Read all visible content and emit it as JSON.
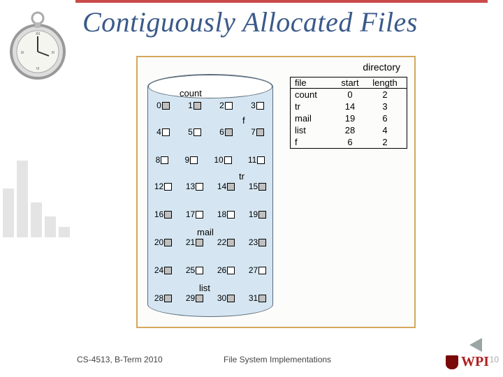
{
  "title": "Contiguously Allocated Files",
  "footer": {
    "course": "CS-4513, B-Term 2010",
    "topic": "File System Implementations",
    "slide": "10",
    "logo_text": "WPI"
  },
  "directory": {
    "title": "directory",
    "headers": {
      "file": "file",
      "start": "start",
      "length": "length"
    },
    "rows": [
      {
        "file": "count",
        "start": "0",
        "length": "2"
      },
      {
        "file": "tr",
        "start": "14",
        "length": "3"
      },
      {
        "file": "mail",
        "start": "19",
        "length": "6"
      },
      {
        "file": "list",
        "start": "28",
        "length": "4"
      },
      {
        "file": "f",
        "start": "6",
        "length": "2"
      }
    ]
  },
  "disk": {
    "labels": {
      "count": "count",
      "f": "f",
      "tr": "tr",
      "mail": "mail",
      "list": "list"
    },
    "rows": [
      [
        {
          "n": "0",
          "u": true
        },
        {
          "n": "1",
          "u": true
        },
        {
          "n": "2",
          "u": false
        },
        {
          "n": "3",
          "u": false
        }
      ],
      [
        {
          "n": "4",
          "u": false
        },
        {
          "n": "5",
          "u": false
        },
        {
          "n": "6",
          "u": true
        },
        {
          "n": "7",
          "u": true
        }
      ],
      [
        {
          "n": "8",
          "u": false
        },
        {
          "n": "9",
          "u": false
        },
        {
          "n": "10",
          "u": false
        },
        {
          "n": "11",
          "u": false
        }
      ],
      [
        {
          "n": "12",
          "u": false
        },
        {
          "n": "13",
          "u": false
        },
        {
          "n": "14",
          "u": true
        },
        {
          "n": "15",
          "u": true
        }
      ],
      [
        {
          "n": "16",
          "u": true
        },
        {
          "n": "17",
          "u": false
        },
        {
          "n": "18",
          "u": false
        },
        {
          "n": "19",
          "u": true
        }
      ],
      [
        {
          "n": "20",
          "u": true
        },
        {
          "n": "21",
          "u": true
        },
        {
          "n": "22",
          "u": true
        },
        {
          "n": "23",
          "u": true
        }
      ],
      [
        {
          "n": "24",
          "u": true
        },
        {
          "n": "25",
          "u": false
        },
        {
          "n": "26",
          "u": false
        },
        {
          "n": "27",
          "u": false
        }
      ],
      [
        {
          "n": "28",
          "u": true
        },
        {
          "n": "29",
          "u": true
        },
        {
          "n": "30",
          "u": true
        },
        {
          "n": "31",
          "u": true
        }
      ]
    ]
  }
}
